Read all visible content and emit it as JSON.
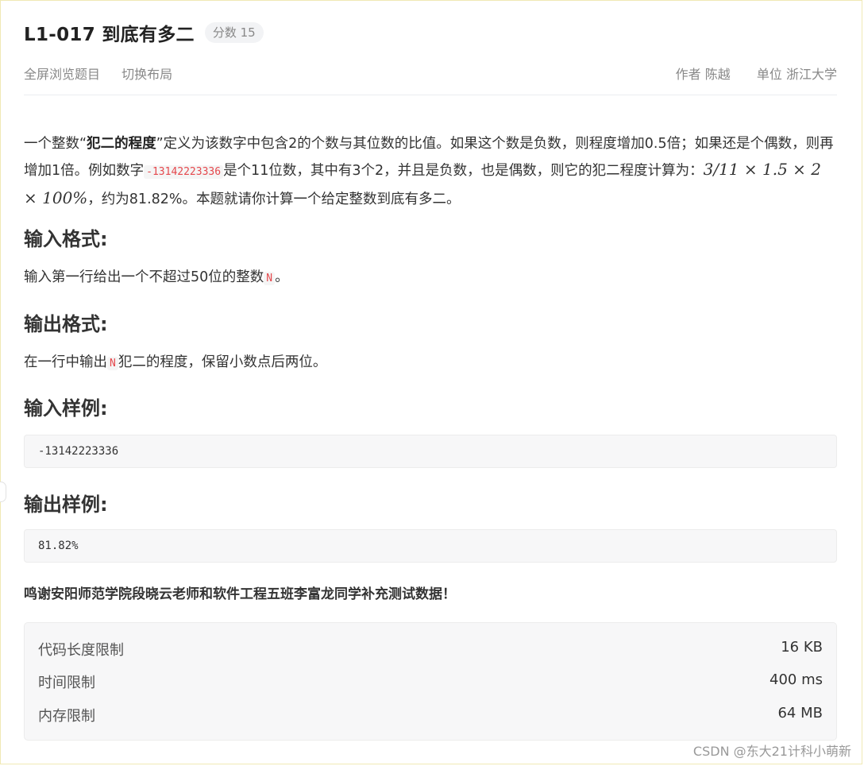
{
  "header": {
    "title": "L1-017 到底有多二",
    "score": "分数 15"
  },
  "toolbar": {
    "fullscreen": "全屏浏览题目",
    "switch_layout": "切换布局",
    "author_label": "作者",
    "author": "陈越",
    "unit_label": "单位",
    "unit": "浙江大学"
  },
  "description": {
    "p1_a": "一个整数“",
    "p1_bold": "犯二的程度",
    "p1_b": "”定义为该数字中包含2的个数与其位数的比值。如果这个数是负数，则程度增加0.5倍；如果还是个偶数，则再增加1倍。例如数字",
    "example_number": "-13142223336",
    "p1_c": "是个11位数，其中有3个2，并且是负数，也是偶数，则它的犯二程度计算为：",
    "formula": "3/11 × 1.5 × 2 × 100%",
    "p1_d": "，约为81.82%。本题就请你计算一个给定整数到底有多二。"
  },
  "sections": {
    "input_format_title": "输入格式:",
    "input_format_a": "输入第一行给出一个不超过50位的整数",
    "input_var": "N",
    "input_format_b": "。",
    "output_format_title": "输出格式:",
    "output_format_a": "在一行中输出",
    "output_var": "N",
    "output_format_b": "犯二的程度，保留小数点后两位。",
    "sample_input_title": "输入样例:",
    "sample_input": "-13142223336",
    "sample_output_title": "输出样例:",
    "sample_output": "81.82%"
  },
  "thanks": "鸣谢安阳师范学院段晓云老师和软件工程五班李富龙同学补充测试数据！",
  "limits": [
    {
      "label": "代码长度限制",
      "value": "16 KB"
    },
    {
      "label": "时间限制",
      "value": "400 ms"
    },
    {
      "label": "内存限制",
      "value": "64 MB"
    }
  ],
  "watermark": "CSDN @东大21计科小萌新"
}
